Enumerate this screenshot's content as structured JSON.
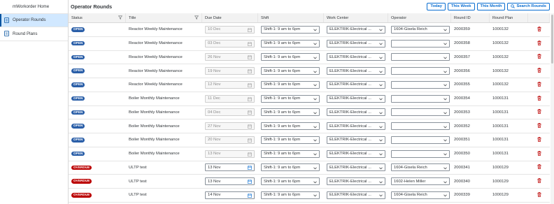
{
  "sidebar": {
    "items": [
      {
        "label": "mWorkorder Home",
        "icon": "home-icon",
        "active": false
      },
      {
        "label": "Operator Rounds",
        "icon": "document-icon",
        "active": true
      },
      {
        "label": "Round Plans",
        "icon": "document-icon",
        "active": false
      }
    ]
  },
  "header": {
    "title": "Operator Rounds",
    "buttons": {
      "today": "Today",
      "this_week": "This Week",
      "this_month": "This Month",
      "search_rounds": "Search Rounds"
    }
  },
  "table": {
    "columns": {
      "status": "Status",
      "title": "Title",
      "due_date": "Due Date",
      "shift": "Shift",
      "work_center": "Work Center",
      "operator": "Operator",
      "round_id": "Round ID",
      "round_plan": "Round Plan"
    },
    "rows": [
      {
        "status": "OPEN",
        "status_type": "open",
        "title": "Reactor Weekly Maintenance",
        "due_date": "10 Dec",
        "date_disabled": true,
        "shift": "Shift-1: 9 am to 6pm",
        "work_center": "ELEKTRIK-Electrical ...",
        "operator": "1604-Gisela Reich",
        "round_id": "2000359",
        "round_plan": "1000132"
      },
      {
        "status": "OPEN",
        "status_type": "open",
        "title": "Reactor Weekly Maintenance",
        "due_date": "03 Dec",
        "date_disabled": true,
        "shift": "Shift-1: 9 am to 6pm",
        "work_center": "ELEKTRIK-Electrical ...",
        "operator": "",
        "round_id": "2000358",
        "round_plan": "1000132"
      },
      {
        "status": "OPEN",
        "status_type": "open",
        "title": "Reactor Weekly Maintenance",
        "due_date": "26 Nov",
        "date_disabled": true,
        "shift": "Shift-1: 9 am to 6pm",
        "work_center": "ELEKTRIK-Electrical ...",
        "operator": "",
        "round_id": "2000357",
        "round_plan": "1000132"
      },
      {
        "status": "OPEN",
        "status_type": "open",
        "title": "Reactor Weekly Maintenance",
        "due_date": "19 Nov",
        "date_disabled": true,
        "shift": "Shift-1: 9 am to 6pm",
        "work_center": "ELEKTRIK-Electrical ...",
        "operator": "",
        "round_id": "2000356",
        "round_plan": "1000132"
      },
      {
        "status": "OPEN",
        "status_type": "open",
        "title": "Reactor Weekly Maintenance",
        "due_date": "12 Nov",
        "date_disabled": true,
        "shift": "Shift-1: 9 am to 6pm",
        "work_center": "ELEKTRIK-Electrical ...",
        "operator": "",
        "round_id": "2000355",
        "round_plan": "1000132"
      },
      {
        "status": "OPEN",
        "status_type": "open",
        "title": "Boiler Monthly Maintenance",
        "due_date": "11 Dec",
        "date_disabled": true,
        "shift": "Shift-1: 9 am to 6pm",
        "work_center": "ELEKTRIK-Electrical ...",
        "operator": "",
        "round_id": "2000354",
        "round_plan": "1000131"
      },
      {
        "status": "OPEN",
        "status_type": "open",
        "title": "Boiler Monthly Maintenance",
        "due_date": "04 Dec",
        "date_disabled": true,
        "shift": "Shift-1: 9 am to 6pm",
        "work_center": "ELEKTRIK-Electrical ...",
        "operator": "",
        "round_id": "2000353",
        "round_plan": "1000131"
      },
      {
        "status": "OPEN",
        "status_type": "open",
        "title": "Boiler Monthly Maintenance",
        "due_date": "27 Nov",
        "date_disabled": true,
        "shift": "Shift-1: 9 am to 6pm",
        "work_center": "ELEKTRIK-Electrical ...",
        "operator": "",
        "round_id": "2000352",
        "round_plan": "1000131"
      },
      {
        "status": "OPEN",
        "status_type": "open",
        "title": "Boiler Monthly Maintenance",
        "due_date": "20 Nov",
        "date_disabled": true,
        "shift": "Shift-1: 9 am to 6pm",
        "work_center": "ELEKTRIK-Electrical ...",
        "operator": "",
        "round_id": "2000351",
        "round_plan": "1000131"
      },
      {
        "status": "OPEN",
        "status_type": "open",
        "title": "Boiler Monthly Maintenance",
        "due_date": "13 Nov",
        "date_disabled": true,
        "shift": "Shift-1: 9 am to 6pm",
        "work_center": "ELEKTRIK-Electrical ...",
        "operator": "",
        "round_id": "2000350",
        "round_plan": "1000131"
      },
      {
        "status": "OVERDUE",
        "status_type": "overdue",
        "title": "ULTP test",
        "due_date": "13 Nov",
        "date_disabled": false,
        "shift": "Shift-1: 9 am to 6pm",
        "work_center": "ELEKTRIK-Electrical ...",
        "operator": "1604-Gisela Reich",
        "round_id": "2000341",
        "round_plan": "1000129"
      },
      {
        "status": "OVERDUE",
        "status_type": "overdue",
        "title": "ULTP test",
        "due_date": "13 Nov",
        "date_disabled": false,
        "shift": "Shift-1: 9 am to 6pm",
        "work_center": "ELEKTRIK-Electrical ...",
        "operator": "1602-Helen Miller",
        "round_id": "2000340",
        "round_plan": "1000129"
      },
      {
        "status": "OVERDUE",
        "status_type": "overdue",
        "title": "ULTP test",
        "due_date": "14 Nov",
        "date_disabled": false,
        "shift": "Shift-1: 9 am to 6pm",
        "work_center": "ELEKTRIK-Electrical ...",
        "operator": "1604-Gisela Reich",
        "round_id": "2000339",
        "round_plan": "1000129"
      }
    ]
  },
  "colors": {
    "accent": "#0a6ed1",
    "open_badge": "#2b5fa8",
    "overdue_badge": "#bb0000",
    "delete_icon": "#bb0000",
    "active_nav": "#d1e8ff"
  }
}
